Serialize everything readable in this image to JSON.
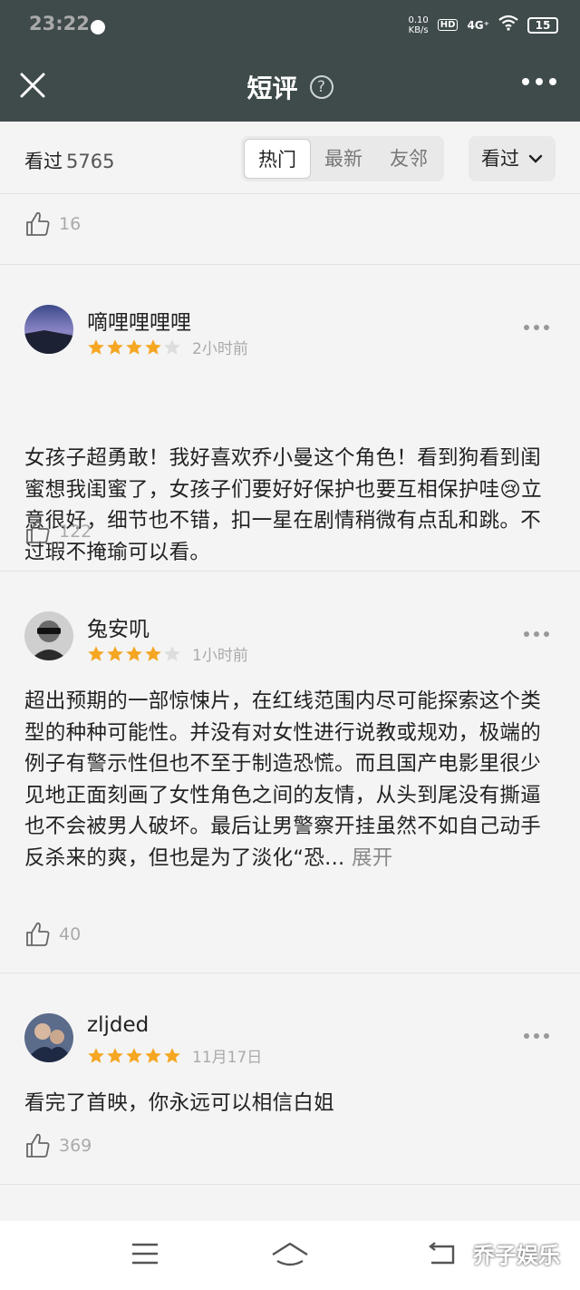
{
  "status_bar": {
    "time": "23:22",
    "net_speed_value": "0.10",
    "net_speed_unit": "KB/s",
    "hd": "HD",
    "signal": "4G⁺",
    "battery": "15"
  },
  "header": {
    "title": "短评",
    "help_glyph": "?"
  },
  "filter": {
    "count_label": "看过",
    "count_value": "5765",
    "tabs": [
      "热门",
      "最新",
      "友邻"
    ],
    "active_tab": "热门",
    "select_label": "看过"
  },
  "first_card_likes": "16",
  "colors": {
    "header_bg": "#3f4a4b",
    "star": "#f5a623",
    "star_empty": "#dddddd"
  },
  "comments": [
    {
      "username": "嘀哩哩哩哩",
      "rating": 4,
      "time": "2小时前",
      "text": "女孩子超勇敢！我好喜欢乔小曼这个角色！看到狗看到闺蜜想我闺蜜了，女孩子们要好好保护也要互相保护哇😢立意很好，细节也不错，扣一星在剧情稍微有点乱和跳。不过瑕不掩瑜可以看。",
      "likes": "122"
    },
    {
      "username": "兔安叽",
      "rating": 4,
      "time": "1小时前",
      "text": "超出预期的一部惊悚片，在红线范围内尽可能探索这个类型的种种可能性。并没有对女性进行说教或规劝，极端的例子有警示性但也不至于制造恐慌。而且国产电影里很少见地正面刻画了女性角色之间的友情，从头到尾没有撕逼也不会被男人破坏。最后让男警察开挂虽然不如自己动手反杀来的爽，但也是为了淡化“恐...",
      "expand": "展开",
      "likes": "40"
    },
    {
      "username": "zljded",
      "rating": 5,
      "time": "11月17日",
      "text": "看完了首映，你永远可以相信白姐",
      "likes": "369"
    }
  ],
  "watermark": "乔子娱乐"
}
